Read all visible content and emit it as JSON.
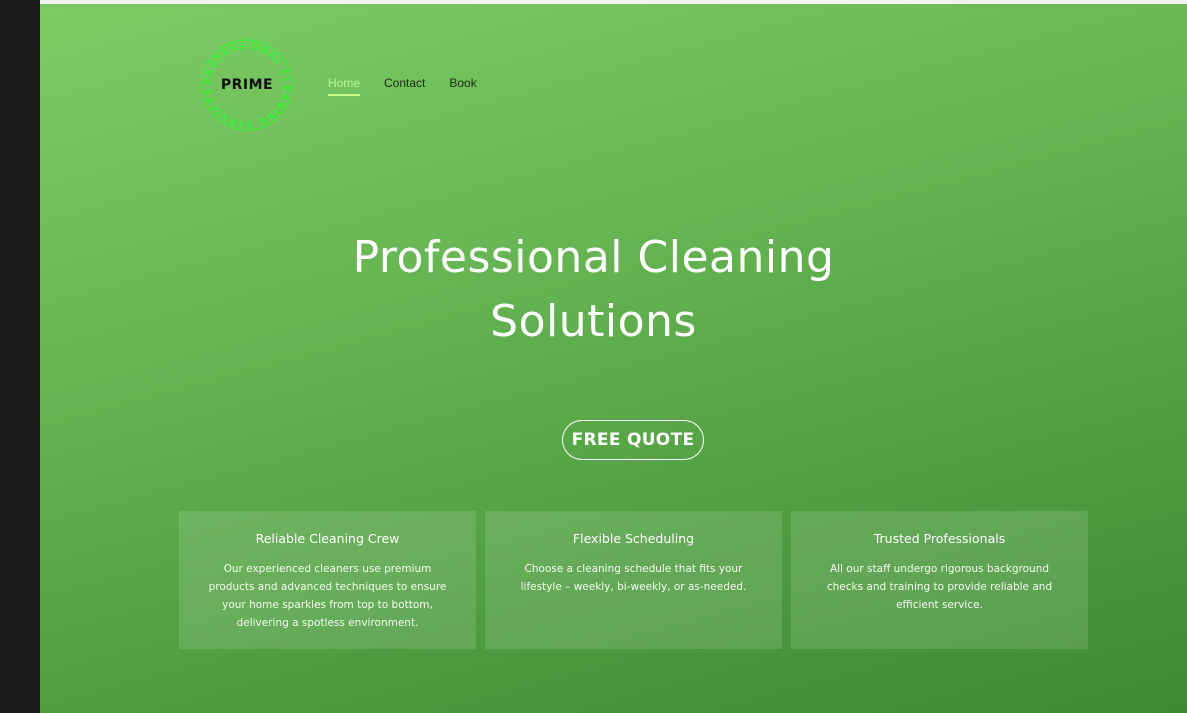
{
  "logo": {
    "wordmark": "PRIME",
    "ring_text": "PROFESSIONAL CLEANING SERVICES",
    "ring_color": "#3cf03a"
  },
  "nav": {
    "items": [
      {
        "label": "Home",
        "active": true
      },
      {
        "label": "Contact",
        "active": false
      },
      {
        "label": "Book",
        "active": false
      }
    ]
  },
  "hero": {
    "headline_line1": "Professional Cleaning",
    "headline_line2": "Solutions",
    "cta_label": "FREE QUOTE"
  },
  "features": [
    {
      "title": "Reliable Cleaning Crew",
      "text": "Our experienced cleaners use premium products and advanced techniques to ensure your home sparkles from top to bottom, delivering a spotless environment."
    },
    {
      "title": "Flexible Scheduling",
      "text": "Choose a cleaning schedule that fits your lifestyle – weekly, bi-weekly, or as-needed."
    },
    {
      "title": "Trusted Professionals",
      "text": "All our staff undergo rigorous background checks and training to provide reliable and efficient service."
    }
  ],
  "colors": {
    "accent": "#c6ff8c",
    "hero_gradient_top": "#7ccc64",
    "hero_gradient_bottom": "#3d8a33"
  }
}
